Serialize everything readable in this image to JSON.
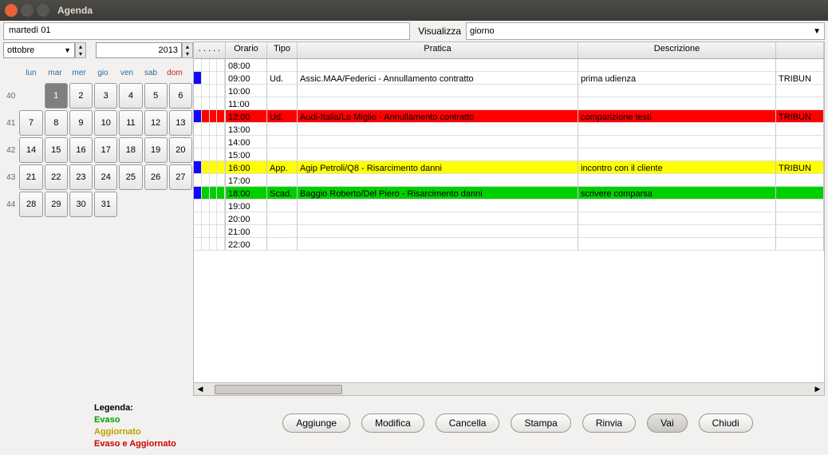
{
  "window": {
    "title": "Agenda"
  },
  "header": {
    "date_display": "martedì 01",
    "view_label": "Visualizza",
    "view_value": "giorno"
  },
  "calendar": {
    "month": "ottobre",
    "year": "2013",
    "dow": [
      "lun",
      "mar",
      "mer",
      "gio",
      "ven",
      "sab",
      "dom"
    ],
    "weeks": [
      {
        "n": "40",
        "d": [
          "",
          "1",
          "2",
          "3",
          "4",
          "5",
          "6"
        ]
      },
      {
        "n": "41",
        "d": [
          "7",
          "8",
          "9",
          "10",
          "11",
          "12",
          "13"
        ]
      },
      {
        "n": "42",
        "d": [
          "14",
          "15",
          "16",
          "17",
          "18",
          "19",
          "20"
        ]
      },
      {
        "n": "43",
        "d": [
          "21",
          "22",
          "23",
          "24",
          "25",
          "26",
          "27"
        ]
      },
      {
        "n": "44",
        "d": [
          "28",
          "29",
          "30",
          "31",
          "",
          "",
          ""
        ]
      }
    ],
    "selected": "1"
  },
  "grid": {
    "headers": {
      "orario": "Orario",
      "tipo": "Tipo",
      "pratica": "Pratica",
      "descrizione": "Descrizione"
    },
    "rows": [
      {
        "time": "08:00",
        "tipo": "",
        "pratica": "",
        "descr": "",
        "extra": "",
        "mark": "",
        "cls": ""
      },
      {
        "time": "09:00",
        "tipo": "Ud.",
        "pratica": "Assic.MAA/Federici - Annullamento contratto",
        "descr": "prima udienza",
        "extra": "TRIBUN",
        "mark": "blue",
        "cls": ""
      },
      {
        "time": "10:00",
        "tipo": "",
        "pratica": "",
        "descr": "",
        "extra": "",
        "mark": "",
        "cls": ""
      },
      {
        "time": "11:00",
        "tipo": "",
        "pratica": "",
        "descr": "",
        "extra": "",
        "mark": "",
        "cls": ""
      },
      {
        "time": "12:00",
        "tipo": "Ud.",
        "pratica": "Audi-Italia/Lo Miglio - Annullamento contratto",
        "descr": "comparizione testi",
        "extra": "TRIBUN",
        "mark": "blue-red",
        "cls": "row-red"
      },
      {
        "time": "13:00",
        "tipo": "",
        "pratica": "",
        "descr": "",
        "extra": "",
        "mark": "",
        "cls": ""
      },
      {
        "time": "14:00",
        "tipo": "",
        "pratica": "",
        "descr": "",
        "extra": "",
        "mark": "",
        "cls": ""
      },
      {
        "time": "15:00",
        "tipo": "",
        "pratica": "",
        "descr": "",
        "extra": "",
        "mark": "",
        "cls": ""
      },
      {
        "time": "16:00",
        "tipo": "App.",
        "pratica": "Agip Petroli/Q8 - Risarcimento danni",
        "descr": "incontro con il cliente",
        "extra": "TRIBUN",
        "mark": "blue",
        "cls": "row-yellow"
      },
      {
        "time": "17:00",
        "tipo": "",
        "pratica": "",
        "descr": "",
        "extra": "",
        "mark": "",
        "cls": ""
      },
      {
        "time": "18:00",
        "tipo": "Scad.",
        "pratica": "Baggio Roberto/Del Piero - Risarcimento danni",
        "descr": "scrivere comparsa",
        "extra": "",
        "mark": "blue",
        "cls": "row-green"
      },
      {
        "time": "19:00",
        "tipo": "",
        "pratica": "",
        "descr": "",
        "extra": "",
        "mark": "",
        "cls": ""
      },
      {
        "time": "20:00",
        "tipo": "",
        "pratica": "",
        "descr": "",
        "extra": "",
        "mark": "",
        "cls": ""
      },
      {
        "time": "21:00",
        "tipo": "",
        "pratica": "",
        "descr": "",
        "extra": "",
        "mark": "",
        "cls": ""
      },
      {
        "time": "22:00",
        "tipo": "",
        "pratica": "",
        "descr": "",
        "extra": "",
        "mark": "",
        "cls": ""
      }
    ]
  },
  "legend": {
    "title": "Legenda:",
    "evaso": "Evaso",
    "aggiornato": "Aggiornato",
    "evaso_agg": "Evaso e Aggiornato"
  },
  "buttons": {
    "aggiunge": "Aggiunge",
    "modifica": "Modifica",
    "cancella": "Cancella",
    "stampa": "Stampa",
    "rinvia": "Rinvia",
    "vai": "Vai",
    "chiudi": "Chiudi"
  }
}
